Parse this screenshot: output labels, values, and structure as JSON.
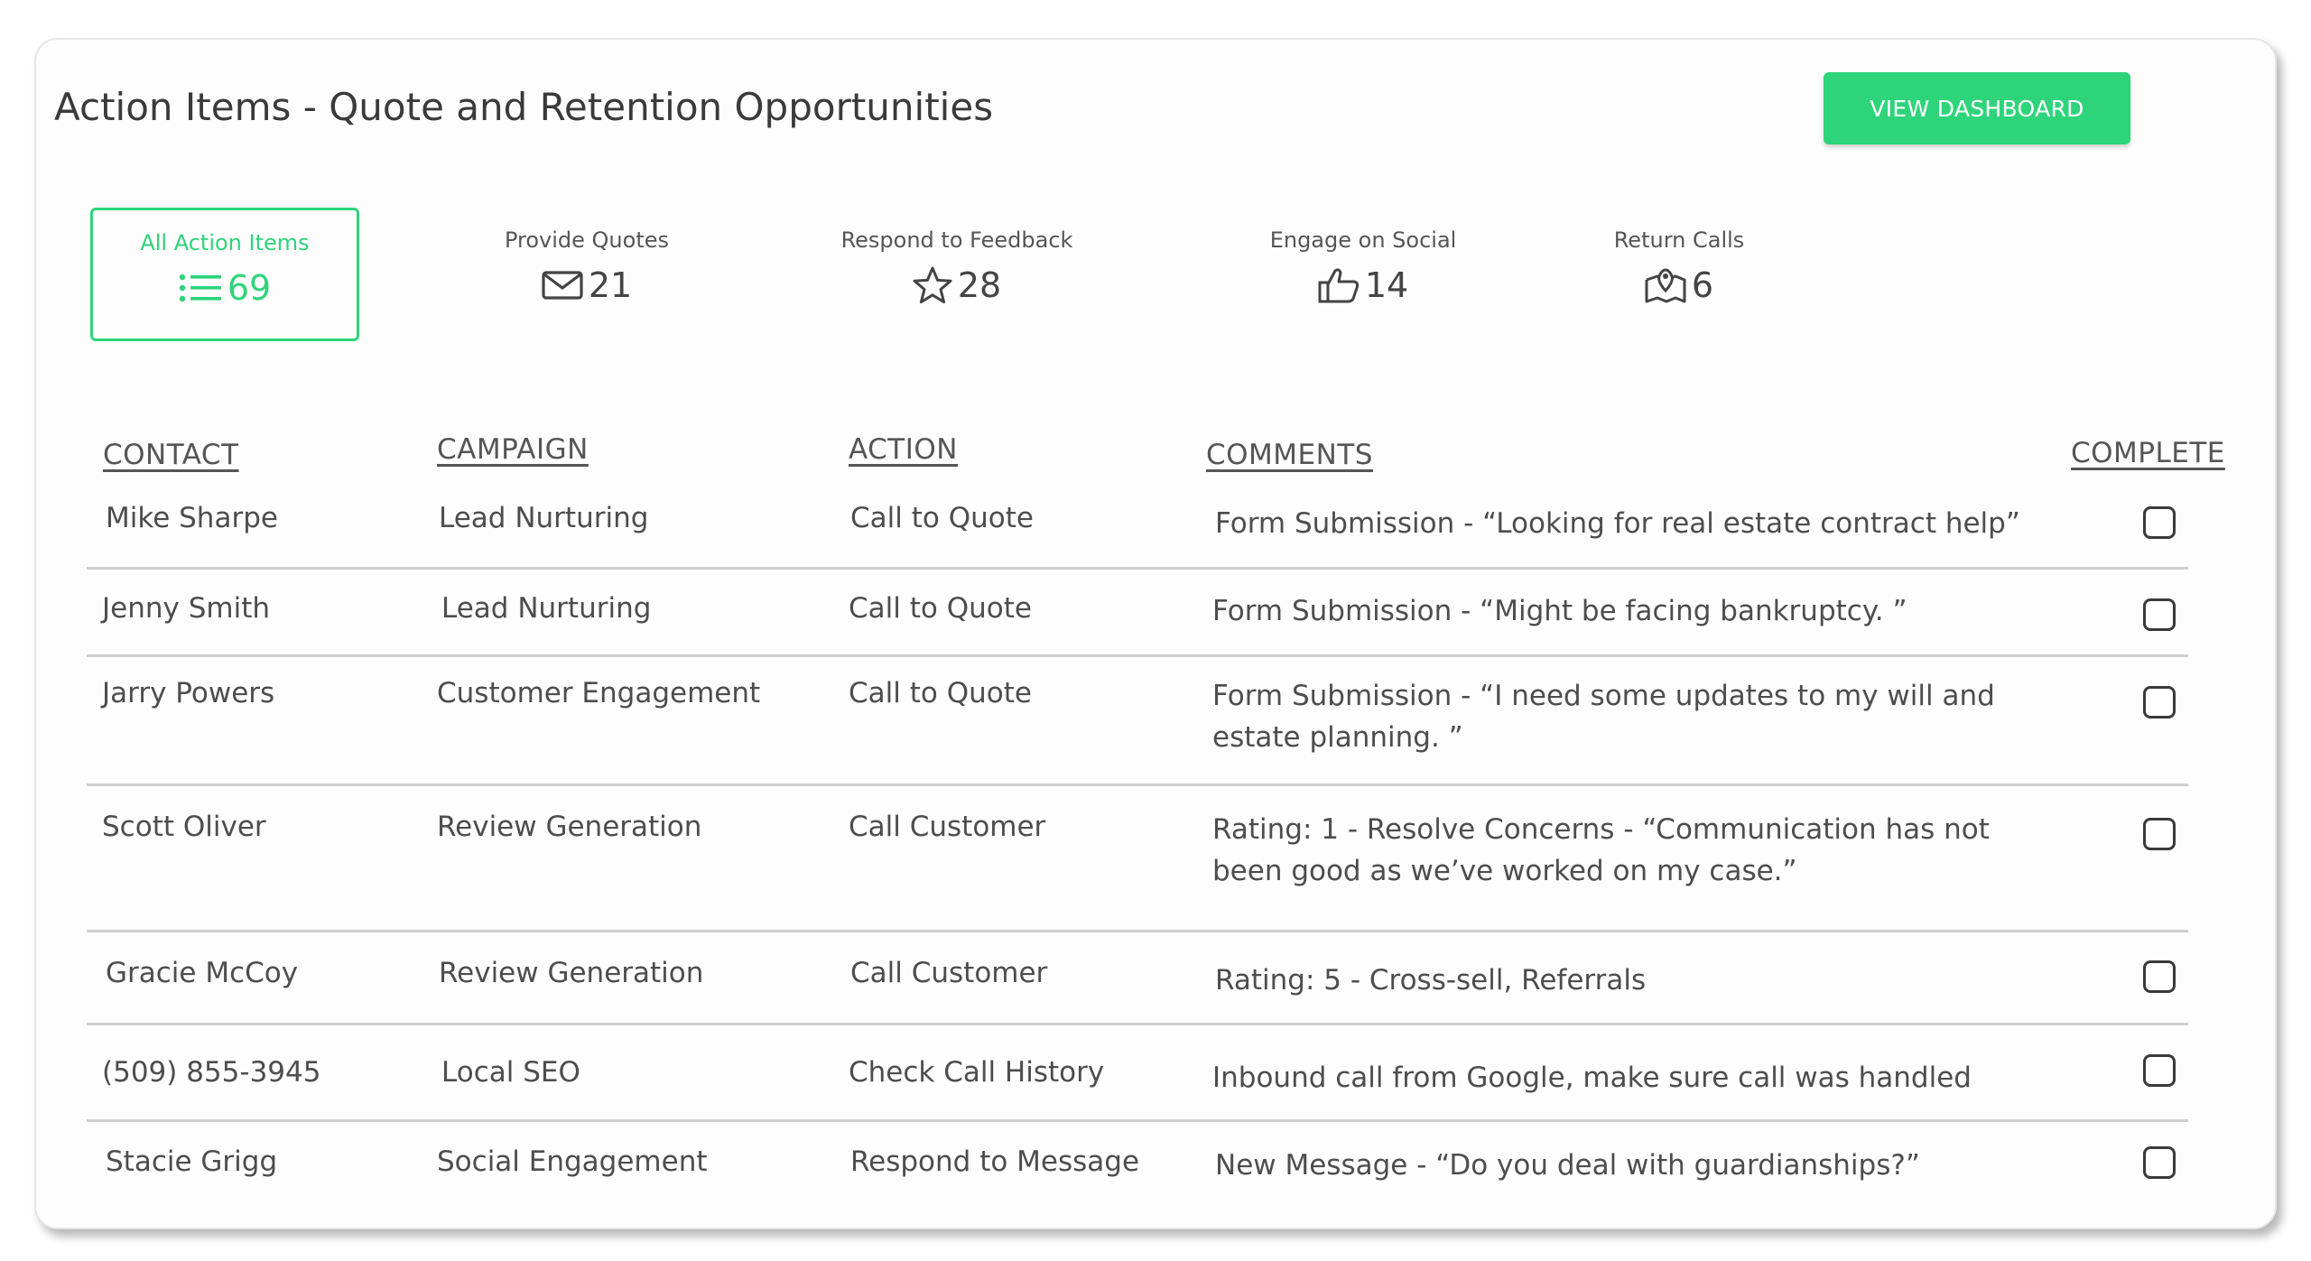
{
  "header": {
    "title": "Action Items - Quote and Retention Opportunities",
    "dashboard_button": "VIEW DASHBOARD"
  },
  "stats": [
    {
      "label": "All Action Items",
      "value": "69",
      "icon": "list-icon",
      "active": true
    },
    {
      "label": "Provide Quotes",
      "value": "21",
      "icon": "envelope-icon",
      "active": false
    },
    {
      "label": "Respond to Feedback",
      "value": "28",
      "icon": "star-icon",
      "active": false
    },
    {
      "label": "Engage on Social",
      "value": "14",
      "icon": "thumbs-up-icon",
      "active": false
    },
    {
      "label": "Return Calls",
      "value": "6",
      "icon": "map-pin-icon",
      "active": false
    }
  ],
  "columns": {
    "contact": "CONTACT",
    "campaign": "CAMPAIGN",
    "action": "ACTION",
    "comments": "COMMENTS",
    "complete": "COMPLETE"
  },
  "rows": [
    {
      "contact": "Mike Sharpe",
      "campaign": "Lead Nurturing",
      "action": "Call to Quote",
      "comment": "Form Submission - “Looking for real estate contract help”",
      "complete": false
    },
    {
      "contact": "Jenny Smith",
      "campaign": "Lead Nurturing",
      "action": "Call to Quote",
      "comment": "Form Submission - “Might be facing bankruptcy. ”",
      "complete": false
    },
    {
      "contact": "Jarry Powers",
      "campaign": "Customer Engagement",
      "action": "Call to Quote",
      "comment": "Form Submission - “I need some updates to my will and estate planning. ”",
      "complete": false
    },
    {
      "contact": "Scott Oliver",
      "campaign": "Review Generation",
      "action": "Call Customer",
      "comment": "Rating: 1 - Resolve Concerns - “Communication has not been good as we’ve worked on my case.”",
      "complete": false
    },
    {
      "contact": "Gracie McCoy",
      "campaign": "Review Generation",
      "action": "Call Customer",
      "comment": "Rating: 5 - Cross-sell, Referrals",
      "complete": false
    },
    {
      "contact": "(509) 855-3945",
      "campaign": "Local SEO",
      "action": "Check Call History",
      "comment": "Inbound call from Google, make sure call was handled",
      "complete": false
    },
    {
      "contact": "Stacie Grigg",
      "campaign": "Social Engagement",
      "action": "Respond to Message",
      "comment": "New Message - “Do you deal with guardianships?”",
      "complete": false
    }
  ],
  "colors": {
    "accent": "#2ed47a",
    "text": "#4d4d4d",
    "divider": "#cfcfcf"
  }
}
